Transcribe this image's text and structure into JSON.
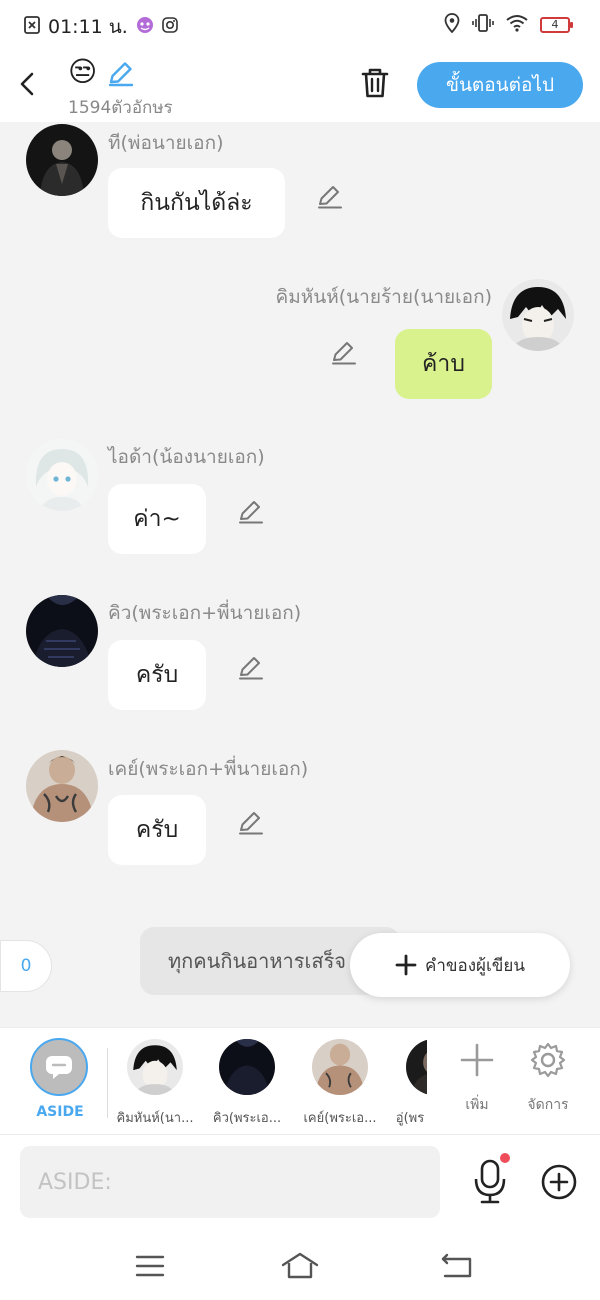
{
  "status_bar": {
    "time": "01:11 น.",
    "battery": "4",
    "icons": [
      "screenshot-icon",
      "alien-icon",
      "instagram-icon",
      "location-icon",
      "vibrate-icon",
      "wifi-icon",
      "battery-icon"
    ]
  },
  "header": {
    "emoji": "😒",
    "char_count": "1594ตัวอักษร",
    "next_label": "ขั้นตอนต่อไป",
    "accent": "#4aa8ef"
  },
  "messages": [
    {
      "name": "ที(พ่อนายเอก)",
      "text": "กินกันได้ล่ะ",
      "side": "left"
    },
    {
      "name": "คิมหันห์(นายร้าย(นายเอก)",
      "text": "ค้าบ",
      "side": "right",
      "bubble_color": "#d9f28e"
    },
    {
      "name": "ไอด้า(น้องนายเอก)",
      "text": "ค่า~",
      "side": "left"
    },
    {
      "name": "คิว(พระเอก+พี่นายเอก)",
      "text": "ครับ",
      "side": "left"
    },
    {
      "name": "เคย์(พระเอก+พี่นายเอก)",
      "text": "ครับ",
      "side": "left"
    }
  ],
  "narration": {
    "counter": "0",
    "text": "ทุกคนกินอาหารเสร็จ",
    "author_button": "คำของผู้เขียน"
  },
  "strip": {
    "aside_label": "ASIDE",
    "characters": [
      "คิมหันห์(นา...",
      "คิว(พระเอ...",
      "เคย์(พระเอ...",
      "อู่(พร"
    ],
    "add_label": "เพิ่ม",
    "manage_label": "จัดการ"
  },
  "input": {
    "placeholder": "ASIDE:"
  }
}
